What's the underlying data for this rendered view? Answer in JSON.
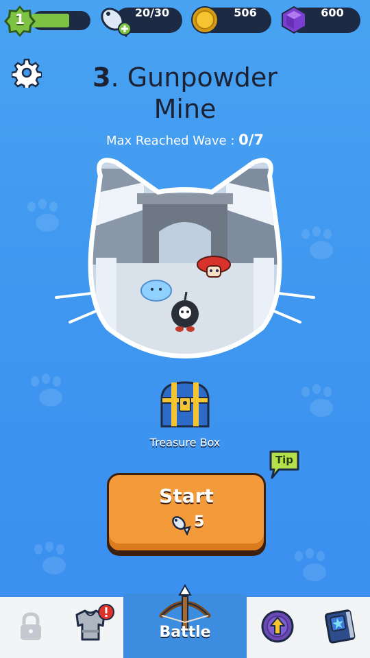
{
  "status": {
    "level": "1",
    "level_progress": 0.63,
    "energy": "20/30",
    "coins": "506",
    "gems": "600"
  },
  "stage": {
    "number": "3",
    "name_line1": "Gunpowder",
    "name_line2": "Mine",
    "wave_label": "Max Reached Wave : ",
    "wave_value": "0/7"
  },
  "reward": {
    "label": "Treasure Box"
  },
  "start": {
    "label": "Start",
    "cost": "5"
  },
  "tip": {
    "label": "Tip"
  },
  "nav": {
    "battle_label": "Battle"
  },
  "colors": {
    "accent": "#3c8ce0",
    "start_button": "#f39a3a",
    "level_bar": "#7dc242"
  },
  "icons": [
    "level-badge-icon",
    "fish-energy-icon",
    "coin-icon",
    "gem-icon",
    "gear-icon",
    "treasure-chest-icon",
    "fish-icon",
    "lock-icon",
    "armor-icon",
    "alert-icon",
    "crossbow-icon",
    "upgrade-icon",
    "skill-book-icon"
  ]
}
